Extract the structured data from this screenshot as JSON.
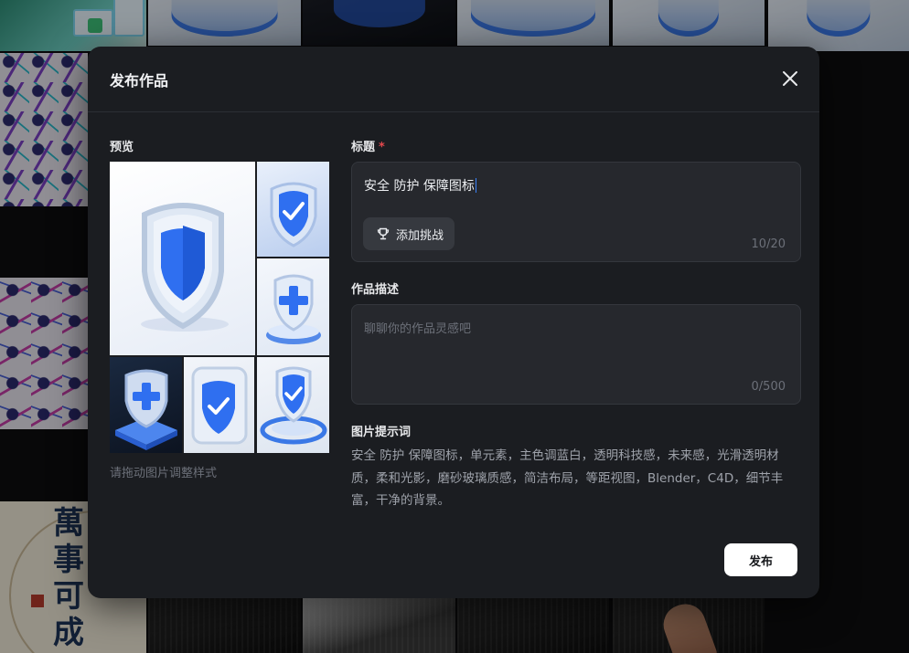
{
  "modal": {
    "title": "发布作品",
    "close_icon": "close-icon"
  },
  "preview": {
    "label": "预览",
    "hint": "请拖动图片调整样式",
    "images": [
      "shield-main",
      "shield-check",
      "shield-plus-disc",
      "shield-plus-base",
      "shield-check-card",
      "shield-check-rings"
    ]
  },
  "title_field": {
    "label": "标题",
    "required_mark": "*",
    "value": "安全 防护 保障图标",
    "counter": "10/20",
    "challenge_button": "添加挑战",
    "challenge_icon": "trophy-icon"
  },
  "description_field": {
    "label": "作品描述",
    "placeholder": "聊聊你的作品灵感吧",
    "counter": "0/500"
  },
  "prompt": {
    "label": "图片提示词",
    "text": "安全 防护 保障图标，单元素，主色调蓝白，透明科技感，未来感，光滑透明材质，柔和光影，磨砂玻璃质感，简洁布局，等距视图，Blender，C4D，细节丰富，干净的背景。"
  },
  "actions": {
    "publish": "发布"
  },
  "colors": {
    "modal_bg": "#1b1d21",
    "field_bg": "#26282d",
    "accent_blue": "#2f6ff0",
    "required_red": "#e5484d"
  }
}
